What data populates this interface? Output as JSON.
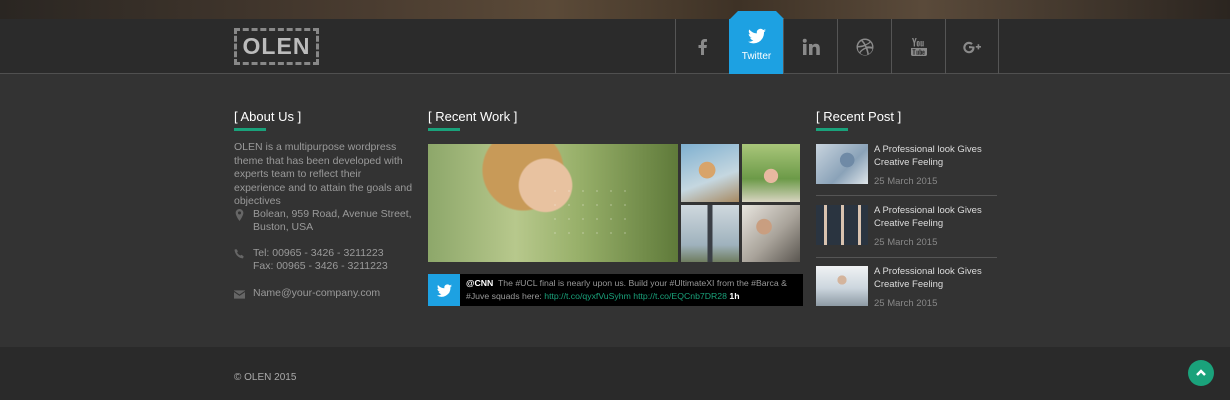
{
  "brand": {
    "logo_text": "OLEN"
  },
  "social": {
    "items": [
      {
        "name": "facebook",
        "label": ""
      },
      {
        "name": "twitter",
        "label": "Twitter",
        "active": true
      },
      {
        "name": "linkedin",
        "label": ""
      },
      {
        "name": "dribbble",
        "label": ""
      },
      {
        "name": "youtube",
        "label": ""
      },
      {
        "name": "google-plus",
        "label": ""
      }
    ],
    "active_color": "#1da1e2"
  },
  "about": {
    "title": "[ About Us ]",
    "text": "OLEN is a multipurpose wordpress theme that has been developed with experts team to reflect their experience and to attain the goals and objectives",
    "address_line1": "Bolean, 959 Road, Avenue Street,",
    "address_line2": "Buston, USA",
    "tel": "Tel: 00965 - 3426 - 3211223",
    "fax": "Fax: 00965 - 3426 - 3211223",
    "email": "Name@your-company.com"
  },
  "recent_work": {
    "title": "[ Recent Work ]",
    "tweet": {
      "handle": "@CNN",
      "text": "The #UCL final is nearly upon us. Build your #UltimateXI from the #Barca & #Juve squads here:",
      "link1": "http://t.co/qyxfVuSyhm",
      "link2": "http://t.co/EQCnb7DR28",
      "time": "1h"
    }
  },
  "recent_post": {
    "title": "[ Recent Post ]",
    "posts": [
      {
        "title": "A Professional look Gives Creative Feeling",
        "date": "25 March 2015"
      },
      {
        "title": "A Professional look Gives Creative Feeling",
        "date": "25 March 2015"
      },
      {
        "title": "A Professional look Gives Creative Feeling",
        "date": "25 March 2015"
      }
    ]
  },
  "footer": {
    "copyright": "© OLEN 2015"
  },
  "colors": {
    "accent": "#1aa27b",
    "twitter": "#1da1e2",
    "background": "#333333"
  }
}
